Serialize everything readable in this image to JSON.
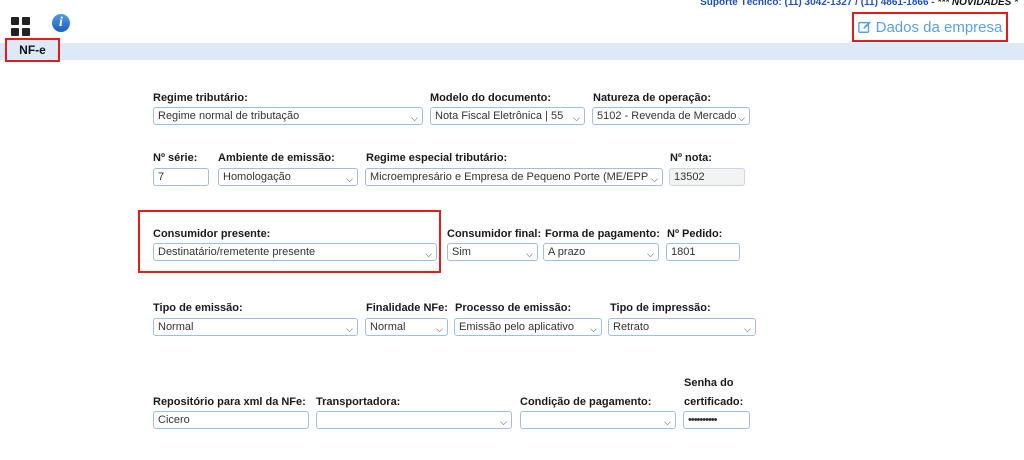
{
  "support": {
    "text": "Suporte Técnico: (11) 3042-1327 / (11) 4861-1866 - ",
    "novidades": "*** NOVIDADES *"
  },
  "tab": {
    "label": "NF-e"
  },
  "dados_empresa": {
    "label": "Dados da empresa"
  },
  "row1": {
    "regime_label": "Regime tributário:",
    "regime_value": "Regime normal de tributação",
    "modelo_label": "Modelo do documento:",
    "modelo_value": "Nota Fiscal Eletrônica | 55",
    "natureza_label": "Natureza de operação:",
    "natureza_value": "5102 - Revenda de Mercado"
  },
  "row2": {
    "serie_label": "Nº série:",
    "serie_value": "7",
    "ambiente_label": "Ambiente de emissão:",
    "ambiente_value": "Homologação",
    "especial_label": "Regime especial tributário:",
    "especial_value": "Microempresário e Empresa de Pequeno Porte (ME/EPP",
    "nota_label": "Nº nota:",
    "nota_value": "13502"
  },
  "row3": {
    "consumidor_label": "Consumidor presente:",
    "consumidor_value": "Destinatário/remetente presente",
    "final_label": "Consumidor final:",
    "final_value": "Sim",
    "forma_label": "Forma de pagamento:",
    "forma_value": "A prazo",
    "pedido_label": "Nº Pedido:",
    "pedido_value": "1801"
  },
  "row4": {
    "tipo_label": "Tipo de emissão:",
    "tipo_value": "Normal",
    "finalidade_label": "Finalidade NFe:",
    "finalidade_value": "Normal",
    "processo_label": "Processo de emissão:",
    "processo_value": "Emissão pelo aplicativo",
    "impressao_label": "Tipo de impressão:",
    "impressao_value": "Retrato"
  },
  "row5": {
    "repo_label": "Repositório para xml da NFe:",
    "repo_value": "Cicero",
    "transp_label": "Transportadora:",
    "transp_value": "",
    "cond_label": "Condição de pagamento:",
    "cond_value": "",
    "senha_label_1": "Senha do",
    "senha_label_2": "certificado:",
    "senha_value": "••••••••••"
  },
  "icons": {
    "apps": "grid-icon",
    "info": "info-icon",
    "edit": "edit-icon",
    "dropdown": "chevron-down-icon"
  }
}
